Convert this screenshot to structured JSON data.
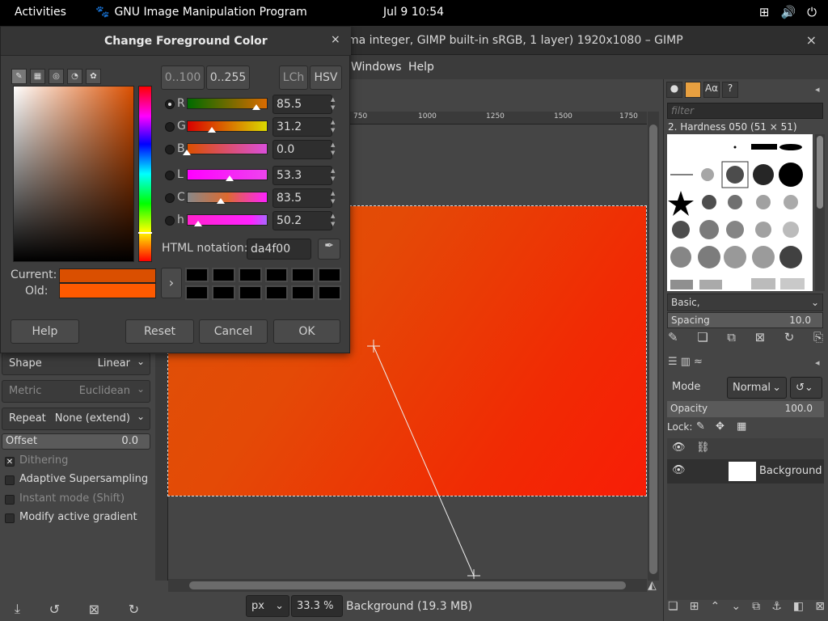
{
  "topbar": {
    "activities": "Activities",
    "app_name": "GNU Image Manipulation Program",
    "clock": "Jul 9  10:54",
    "icons": [
      "network-icon",
      "volume-icon",
      "power-icon"
    ]
  },
  "window": {
    "title": "ma integer, GIMP built-in sRGB, 1 layer) 1920x1080 – GIMP",
    "close": "×"
  },
  "menubar": [
    "Windows",
    "Help"
  ],
  "ruler": {
    "labels": [
      "750",
      "1000",
      "1250",
      "1500",
      "1750"
    ]
  },
  "statusbar": {
    "unit": "px",
    "zoom": "33.3 %",
    "info": "Background (19.3 MB)"
  },
  "tool_options": {
    "shape": {
      "label": "Shape",
      "value": "Linear"
    },
    "metric": {
      "label": "Metric",
      "value": "Euclidean"
    },
    "repeat": {
      "label": "Repeat",
      "value": "None (extend)"
    },
    "offset": {
      "label": "Offset",
      "value": "0.0"
    },
    "checks": [
      {
        "label": "Dithering",
        "checked": true,
        "dim": true
      },
      {
        "label": "Adaptive Supersampling",
        "checked": false,
        "dim": false
      },
      {
        "label": "Instant mode  (Shift)",
        "checked": false,
        "dim": true
      },
      {
        "label": "Modify active gradient",
        "checked": false,
        "dim": false
      }
    ]
  },
  "brushes": {
    "filter_placeholder": "filter",
    "selected": "2. Hardness 050 (51 × 51)",
    "set": "Basic,",
    "spacing_label": "Spacing",
    "spacing_value": "10.0"
  },
  "layers": {
    "mode_label": "Mode",
    "mode_value": "Normal",
    "opacity_label": "Opacity",
    "opacity_value": "100.0",
    "lock_label": "Lock:",
    "layer_name": "Background"
  },
  "dialog": {
    "title": "Change Foreground Color",
    "close": "×",
    "range_buttons": [
      "0..100",
      "0..255"
    ],
    "mode_buttons": [
      "LCh",
      "HSV"
    ],
    "channels": [
      {
        "ch": "R",
        "value": "85.5",
        "selected": true,
        "pos": 0.855,
        "grad": "linear-gradient(to right,#006b00,#da6b00)"
      },
      {
        "ch": "G",
        "value": "31.2",
        "selected": false,
        "pos": 0.312,
        "grad": "linear-gradient(to right,#da0000,#dada00)"
      },
      {
        "ch": "B",
        "value": "0.0",
        "selected": false,
        "pos": 0.0,
        "grad": "linear-gradient(to right,#da4f00,#da4fda)"
      },
      {
        "ch": "L",
        "value": "53.3",
        "selected": false,
        "pos": 0.533,
        "grad": "linear-gradient(to right,#ff00ff,#ee44ee)"
      },
      {
        "ch": "C",
        "value": "83.5",
        "selected": false,
        "pos": 0.42,
        "grad": "linear-gradient(to right,#888,#dd6a2f,#ff22ff)"
      },
      {
        "ch": "h",
        "value": "50.2",
        "selected": false,
        "pos": 0.14,
        "grad": "linear-gradient(to right,#ff22cc,#ff22ff 80%,#aa66ff)"
      }
    ],
    "html_label": "HTML notation:",
    "html_value": "da4f00",
    "current_label": "Current:",
    "old_label": "Old:",
    "current_color": "#da4f00",
    "old_color": "#ff5a00",
    "buttons": {
      "help": "Help",
      "reset": "Reset",
      "cancel": "Cancel",
      "ok": "OK"
    }
  }
}
